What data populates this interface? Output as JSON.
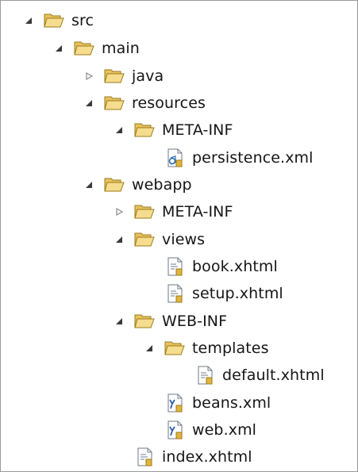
{
  "tree": {
    "nodes": [
      {
        "label": "src",
        "type": "folder",
        "expanded": true,
        "depth": 0
      },
      {
        "label": "main",
        "type": "folder",
        "expanded": true,
        "depth": 1
      },
      {
        "label": "java",
        "type": "folder",
        "expanded": false,
        "depth": 2
      },
      {
        "label": "resources",
        "type": "folder",
        "expanded": true,
        "depth": 2
      },
      {
        "label": "META-INF",
        "type": "folder",
        "expanded": true,
        "depth": 3
      },
      {
        "label": "persistence.xml",
        "type": "persistence-xml",
        "depth": 4
      },
      {
        "label": "webapp",
        "type": "folder",
        "expanded": true,
        "depth": 2
      },
      {
        "label": "META-INF",
        "type": "folder",
        "expanded": false,
        "depth": 3
      },
      {
        "label": "views",
        "type": "folder",
        "expanded": true,
        "depth": 3
      },
      {
        "label": "book.xhtml",
        "type": "xhtml",
        "depth": 4
      },
      {
        "label": "setup.xhtml",
        "type": "xhtml",
        "depth": 4
      },
      {
        "label": "WEB-INF",
        "type": "folder",
        "expanded": true,
        "depth": 3
      },
      {
        "label": "templates",
        "type": "folder",
        "expanded": true,
        "depth": 4
      },
      {
        "label": "default.xhtml",
        "type": "xhtml",
        "depth": 5
      },
      {
        "label": "beans.xml",
        "type": "y-xml",
        "depth": 4
      },
      {
        "label": "web.xml",
        "type": "y-xml",
        "depth": 4
      },
      {
        "label": "index.xhtml",
        "type": "xhtml",
        "depth": 3
      }
    ]
  }
}
